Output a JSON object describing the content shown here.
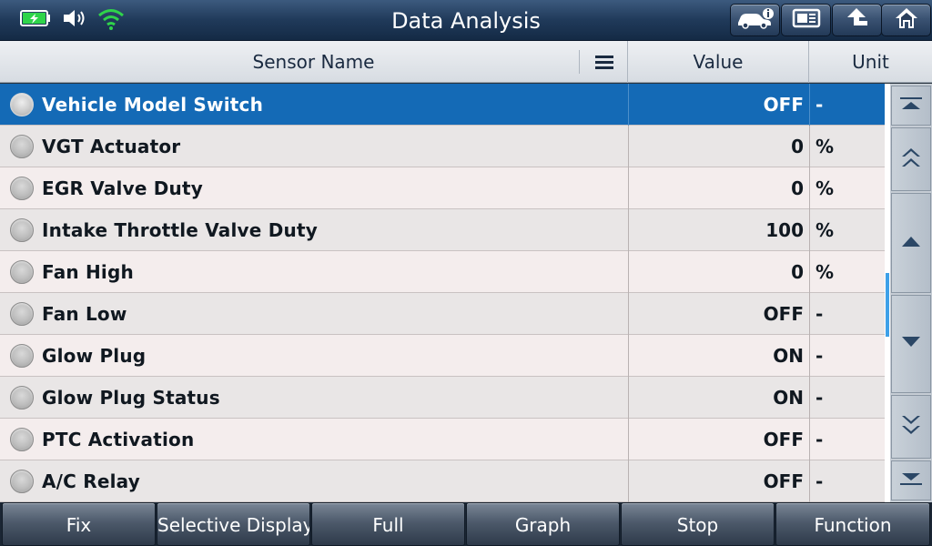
{
  "header": {
    "title": "Data Analysis",
    "status_icons": [
      "battery-icon",
      "speaker-icon",
      "wifi-icon"
    ],
    "buttons": [
      "vehicle-info-icon",
      "report-icon",
      "back-icon",
      "home-icon"
    ]
  },
  "table": {
    "columns": [
      "Sensor Name",
      "Value",
      "Unit"
    ],
    "rows": [
      {
        "name": "Vehicle Model Switch",
        "value": "OFF",
        "unit": "-"
      },
      {
        "name": "VGT Actuator",
        "value": "0",
        "unit": "%"
      },
      {
        "name": "EGR Valve Duty",
        "value": "0",
        "unit": "%"
      },
      {
        "name": "Intake Throttle Valve Duty",
        "value": "100",
        "unit": "%"
      },
      {
        "name": "Fan High",
        "value": "0",
        "unit": "%"
      },
      {
        "name": "Fan Low",
        "value": "OFF",
        "unit": "-"
      },
      {
        "name": "Glow Plug",
        "value": "ON",
        "unit": "-"
      },
      {
        "name": "Glow Plug Status",
        "value": "ON",
        "unit": "-"
      },
      {
        "name": "PTC Activation",
        "value": "OFF",
        "unit": "-"
      },
      {
        "name": "A/C Relay",
        "value": "OFF",
        "unit": "-"
      }
    ],
    "selected_row_color": "#146ab6"
  },
  "scroll_buttons": [
    "scroll-top-icon",
    "page-up-icon",
    "line-up-icon",
    "line-down-icon",
    "page-down-icon",
    "scroll-bottom-icon"
  ],
  "toolbar": {
    "buttons": [
      "Fix",
      "Selective Display",
      "Full",
      "Graph",
      "Stop",
      "Function"
    ]
  }
}
